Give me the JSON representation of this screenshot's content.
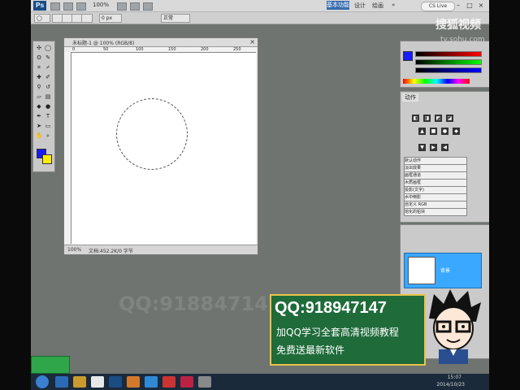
{
  "app": {
    "logo_text": "Ps",
    "zoom_value": "100%",
    "workspace_label": "基本功能",
    "workspace_items": [
      "设计",
      "绘画",
      "»"
    ],
    "cs_live_label": "CS Live"
  },
  "options": {
    "feather_value": "0 px",
    "style_value": "正常"
  },
  "document": {
    "title": "未标题-1 @ 100% (RGB/8)",
    "zoom": "100%",
    "info": "文档:452.2K/0 字节",
    "ruler_numbers": [
      "0",
      "50",
      "100",
      "150",
      "200",
      "250"
    ]
  },
  "panels": {
    "styles_tab": "动作",
    "actions": [
      "默认动作",
      "淡出效果",
      "画框通道",
      "木质画框",
      "投影(文字)",
      "水中倒影",
      "自定义 RGB",
      "熔化的铅块"
    ],
    "layer_name": "背景"
  },
  "overlay": {
    "faint_text": "QQ:918847147"
  },
  "promo": {
    "qq": "QQ:918947147",
    "line1": "加QQ学习全套高清视频教程",
    "line2": "免费送最新软件"
  },
  "watermark": {
    "brand": "搜狐视频",
    "url": "tv.sohu.com"
  },
  "taskbar": {
    "time": "15:07",
    "date": "2014/10/23"
  },
  "colors": {
    "foreground": "#1a1aff",
    "background": "#ffee00",
    "promo_bg": "#1f6b3a",
    "layer_highlight": "#3aa8ff"
  }
}
